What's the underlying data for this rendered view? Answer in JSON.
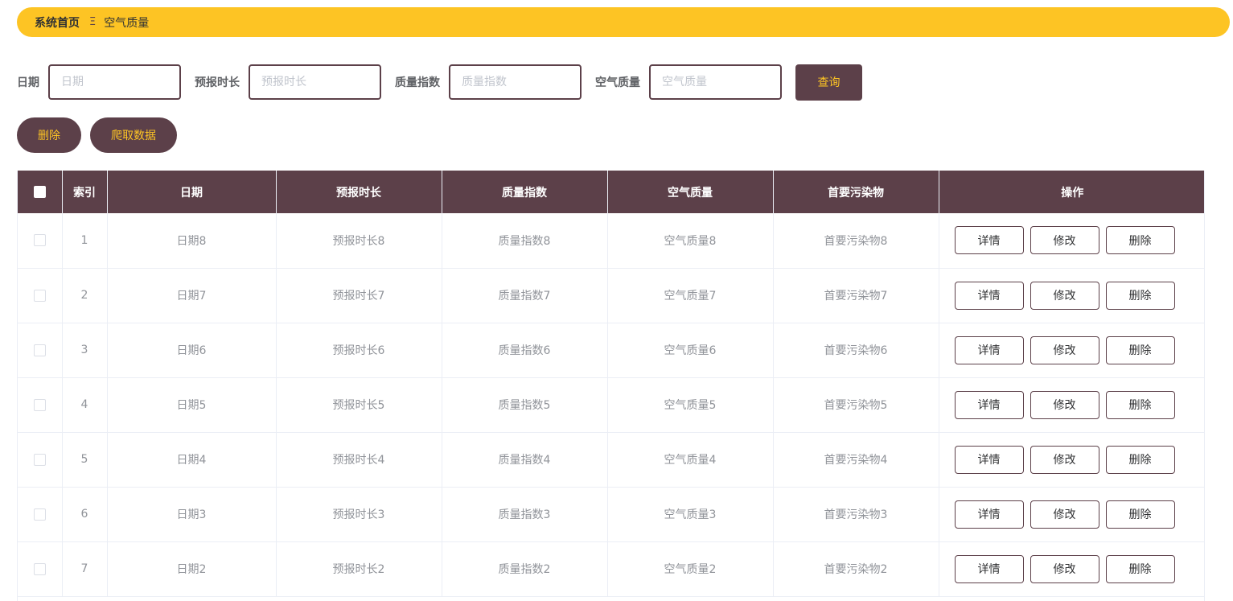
{
  "breadcrumb": {
    "home": "系统首页",
    "separator": "Ξ",
    "current": "空气质量"
  },
  "search": {
    "date_label": "日期",
    "date_placeholder": "日期",
    "forecast_label": "预报时长",
    "forecast_placeholder": "预报时长",
    "aqi_label": "质量指数",
    "aqi_placeholder": "质量指数",
    "quality_label": "空气质量",
    "quality_placeholder": "空气质量",
    "query_label": "查询"
  },
  "actions": {
    "delete_label": "删除",
    "crawl_label": "爬取数据"
  },
  "table": {
    "columns": [
      "",
      "索引",
      "日期",
      "预报时长",
      "质量指数",
      "空气质量",
      "首要污染物",
      "操作"
    ],
    "row_buttons": {
      "detail": "详情",
      "edit": "修改",
      "delete": "删除"
    },
    "rows": [
      {
        "index": "1",
        "date": "日期8",
        "forecast": "预报时长8",
        "aqi": "质量指数8",
        "quality": "空气质量8",
        "pollutant": "首要污染物8"
      },
      {
        "index": "2",
        "date": "日期7",
        "forecast": "预报时长7",
        "aqi": "质量指数7",
        "quality": "空气质量7",
        "pollutant": "首要污染物7"
      },
      {
        "index": "3",
        "date": "日期6",
        "forecast": "预报时长6",
        "aqi": "质量指数6",
        "quality": "空气质量6",
        "pollutant": "首要污染物6"
      },
      {
        "index": "4",
        "date": "日期5",
        "forecast": "预报时长5",
        "aqi": "质量指数5",
        "quality": "空气质量5",
        "pollutant": "首要污染物5"
      },
      {
        "index": "5",
        "date": "日期4",
        "forecast": "预报时长4",
        "aqi": "质量指数4",
        "quality": "空气质量4",
        "pollutant": "首要污染物4"
      },
      {
        "index": "6",
        "date": "日期3",
        "forecast": "预报时长3",
        "aqi": "质量指数3",
        "quality": "空气质量3",
        "pollutant": "首要污染物3"
      },
      {
        "index": "7",
        "date": "日期2",
        "forecast": "预报时长2",
        "aqi": "质量指数2",
        "quality": "空气质量2",
        "pollutant": "首要污染物2"
      }
    ]
  },
  "colors": {
    "accent": "#fdc424",
    "primary": "#5c4049"
  }
}
